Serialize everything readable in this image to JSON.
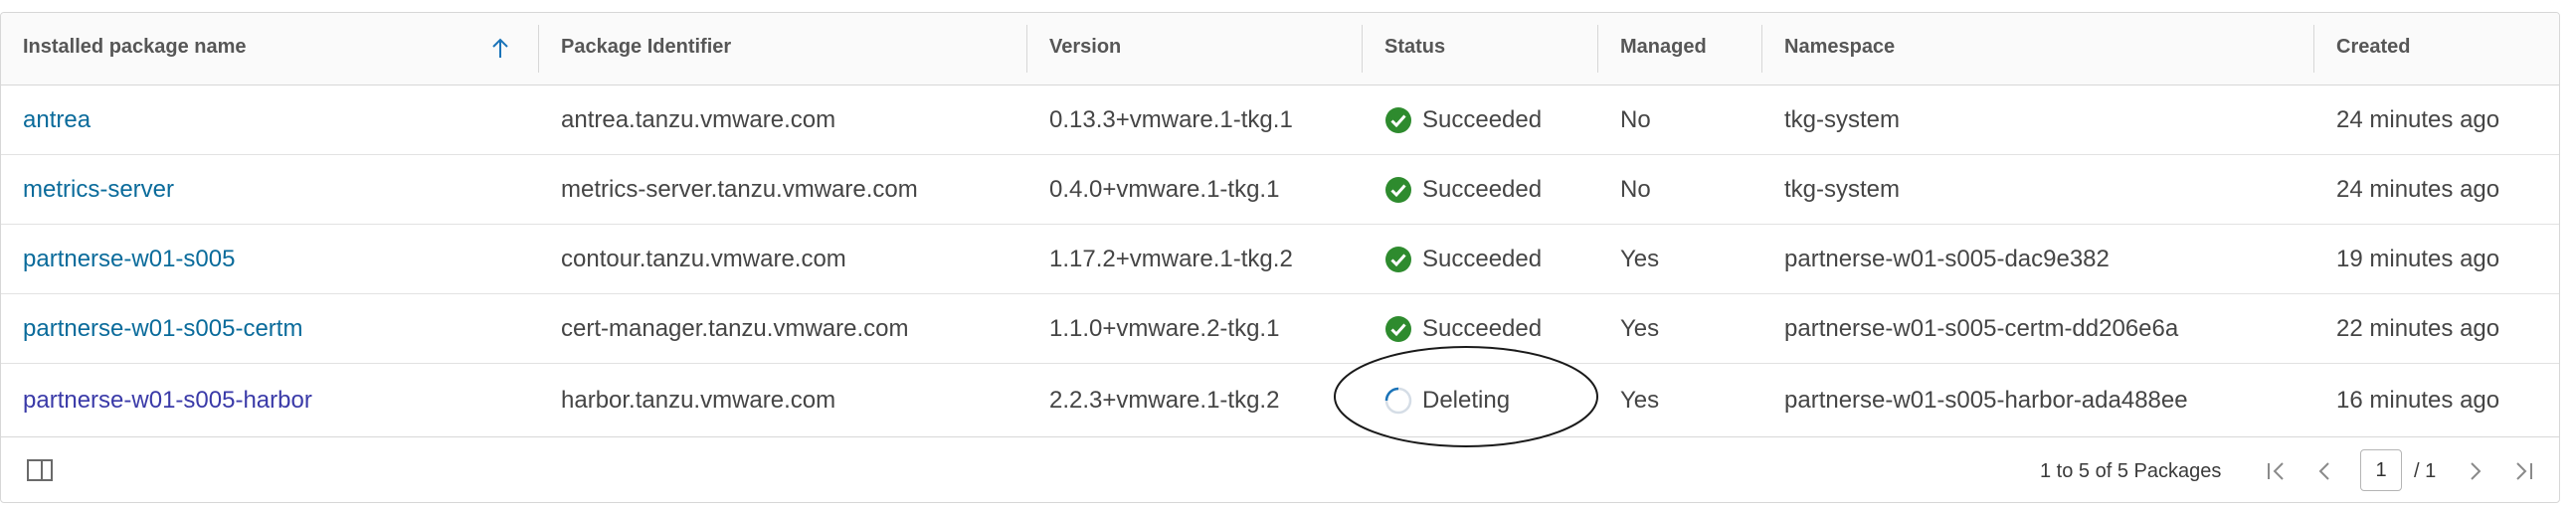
{
  "table": {
    "columns": [
      {
        "key": "name",
        "label": "Installed package name"
      },
      {
        "key": "identifier",
        "label": "Package Identifier"
      },
      {
        "key": "version",
        "label": "Version"
      },
      {
        "key": "status",
        "label": "Status"
      },
      {
        "key": "managed",
        "label": "Managed"
      },
      {
        "key": "namespace",
        "label": "Namespace"
      },
      {
        "key": "created",
        "label": "Created"
      }
    ],
    "sort": {
      "column": "name",
      "direction": "ascending",
      "icon": "arrow-up-icon"
    },
    "rows": [
      {
        "name": "antrea",
        "identifier": "antrea.tanzu.vmware.com",
        "version": "0.13.3+vmware.1-tkg.1",
        "status": "Succeeded",
        "status_icon": "check-circle-icon",
        "managed": "No",
        "namespace": "tkg-system",
        "created": "24 minutes ago"
      },
      {
        "name": "metrics-server",
        "identifier": "metrics-server.tanzu.vmware.com",
        "version": "0.4.0+vmware.1-tkg.1",
        "status": "Succeeded",
        "status_icon": "check-circle-icon",
        "managed": "No",
        "namespace": "tkg-system",
        "created": "24 minutes ago"
      },
      {
        "name": "partnerse-w01-s005",
        "identifier": "contour.tanzu.vmware.com",
        "version": "1.17.2+vmware.1-tkg.2",
        "status": "Succeeded",
        "status_icon": "check-circle-icon",
        "managed": "Yes",
        "namespace": "partnerse-w01-s005-dac9e382",
        "created": "19 minutes ago"
      },
      {
        "name": "partnerse-w01-s005-certm",
        "identifier": "cert-manager.tanzu.vmware.com",
        "version": "1.1.0+vmware.2-tkg.1",
        "status": "Succeeded",
        "status_icon": "check-circle-icon",
        "managed": "Yes",
        "namespace": "partnerse-w01-s005-certm-dd206e6a",
        "created": "22 minutes ago"
      },
      {
        "name": "partnerse-w01-s005-harbor",
        "identifier": "harbor.tanzu.vmware.com",
        "version": "2.2.3+vmware.1-tkg.2",
        "status": "Deleting",
        "status_icon": "spinner-icon",
        "managed": "Yes",
        "namespace": "partnerse-w01-s005-harbor-ada488ee",
        "created": "16 minutes ago"
      }
    ]
  },
  "footer": {
    "column_toggle_icon": "column-toggle-icon",
    "range_text": "1 to 5 of 5 Packages",
    "current_page": "1",
    "total_pages": "/ 1",
    "first_icon": "first-page-icon",
    "prev_icon": "previous-page-icon",
    "next_icon": "next-page-icon",
    "last_icon": "last-page-icon"
  },
  "colors": {
    "link": "#0a6b9b",
    "visited_link": "#3a3aa8",
    "success": "#2e8b2e",
    "spinner": "#1a73b8",
    "header_bg": "#fafafa",
    "border": "#d7d7d7"
  }
}
